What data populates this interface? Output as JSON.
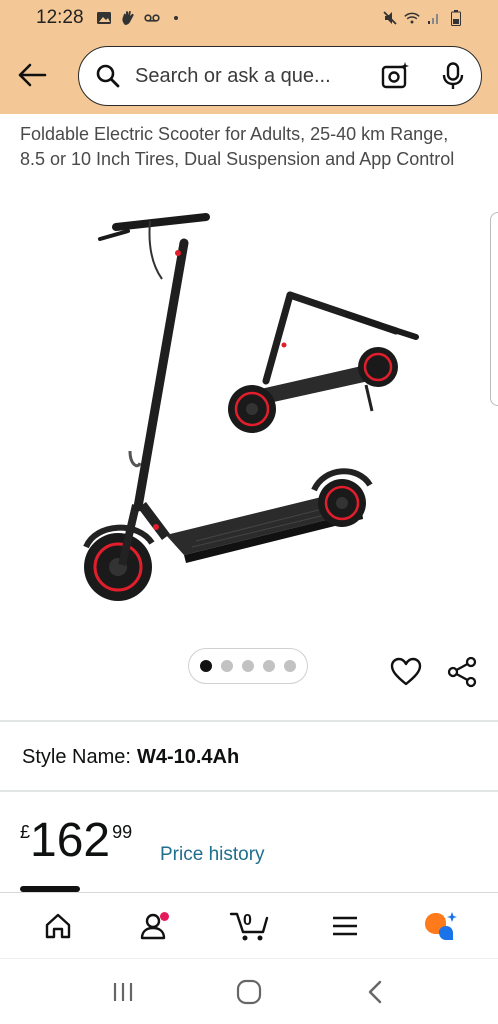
{
  "status_bar": {
    "time": "12:28",
    "left_icons": [
      "image-icon",
      "hand-icon",
      "voicemail-icon",
      "dot-icon"
    ],
    "right_icons": [
      "mute-icon",
      "wifi-icon",
      "signal-icon",
      "battery-icon"
    ],
    "background": "#f3c896"
  },
  "header": {
    "search_placeholder": "Search or ask a que...",
    "background": "#f3c896"
  },
  "product": {
    "title_partial": "",
    "title": "Foldable Electric Scooter for Adults, 25-40 km Range, 8.5 or 10 Inch Tires, Dual Suspension and App Control",
    "image_count": 5,
    "active_image": 1
  },
  "style": {
    "label": "Style Name:",
    "value": "W4-10.4Ah"
  },
  "price": {
    "symbol": "£",
    "whole": "162",
    "fraction": "99",
    "history_label": "Price history"
  },
  "bottom_nav": {
    "items": [
      "home-icon",
      "account-icon",
      "cart-icon",
      "menu-icon",
      "rufus-icon"
    ],
    "cart_count": "0",
    "account_badge_color": "#e6195b"
  },
  "colors": {
    "link": "#1f6e8c",
    "accent_red": "#e11e2b"
  }
}
